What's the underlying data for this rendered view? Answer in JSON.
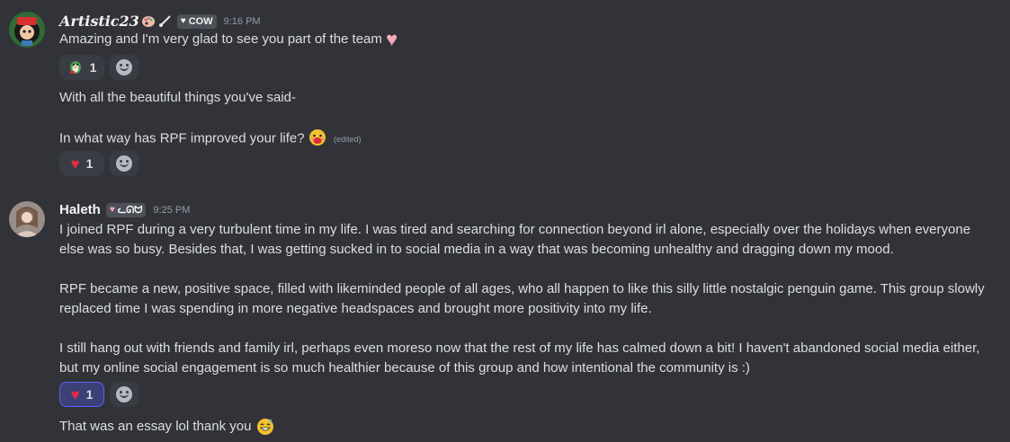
{
  "messages": [
    {
      "username": "Artistic23",
      "tag": "COW",
      "time": "9:16 PM",
      "lines": [
        "Amazing and I'm very glad to see you part of the team",
        "With all the beautiful things you've said-",
        "In what way has RPF improved your life?"
      ],
      "edited_label": "(edited)",
      "reactions": [
        {
          "emoji": "penguin-emoji",
          "count": "1"
        },
        {
          "emoji": "heart-emoji",
          "count": "1"
        }
      ]
    },
    {
      "username": "Haleth",
      "tag": "ᓚᘏᗢ",
      "time": "9:25 PM",
      "paragraphs": [
        "I joined RPF during a very turbulent time in my life. I was tired and searching for connection beyond irl alone, especially over the holidays when everyone else was so busy. Besides that, I was getting sucked in to social media in a way that was becoming unhealthy and dragging down my mood.",
        "RPF became a new, positive space, filled with likeminded people of all ages, who all happen to like this silly little nostalgic penguin game. This group slowly replaced time I was spending in more negative headspaces and brought more positivity into my life.",
        "I still hang out with friends and family irl, perhaps even moreso now that the rest of my life has calmed down a bit! I haven't abandoned social media either, but my online social engagement is so much healthier because of this group and how intentional the community is :)"
      ],
      "reactions": [
        {
          "emoji": "heart-emoji",
          "count": "1"
        }
      ],
      "followup": "That was an essay lol thank you"
    }
  ],
  "colors": {
    "background": "#323339",
    "text": "#dbdee1",
    "timestamp": "#949ba4",
    "reaction_bg": "#3a3c43",
    "reaction_active_border": "#5865f2",
    "heart": "#dd2e44"
  }
}
